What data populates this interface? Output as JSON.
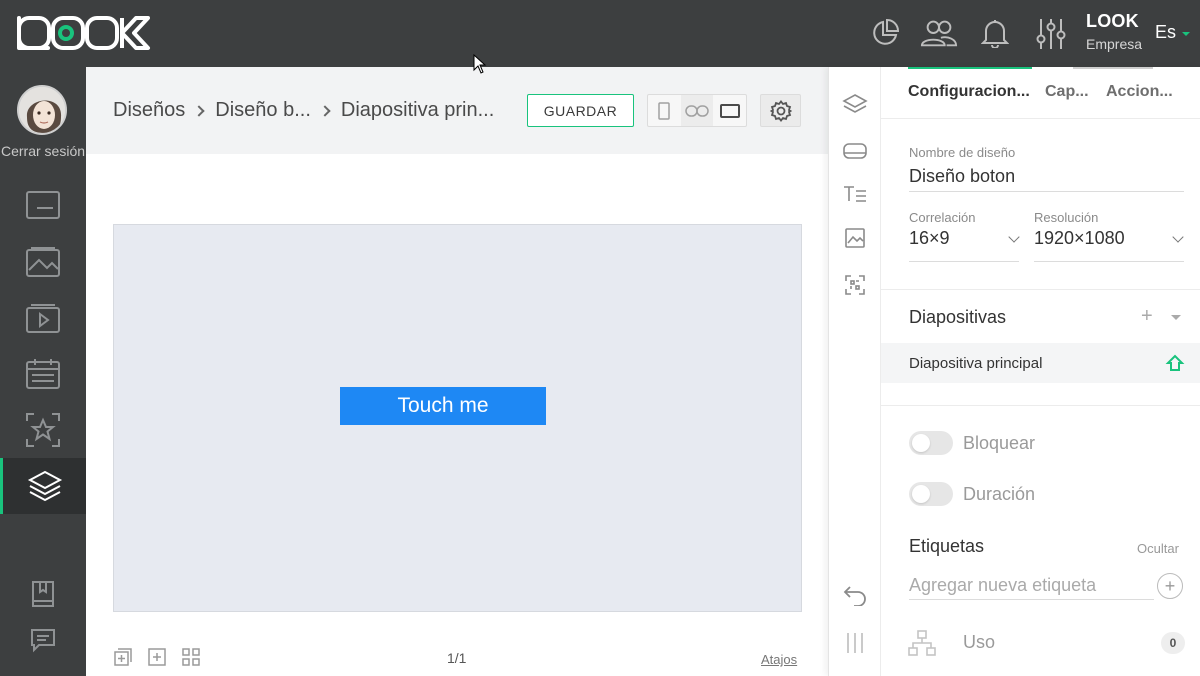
{
  "header": {
    "logo_text": "LOOK",
    "user_name": "LOOK",
    "company": "Empresa",
    "language": "Es",
    "icons": [
      "pie-chart-icon",
      "users-icon",
      "bell-icon",
      "sliders-icon"
    ]
  },
  "sidebar": {
    "logout_label": "Cerrar sesión",
    "items": [
      "screens-icon",
      "images-icon",
      "playlist-icon",
      "calendar-icon",
      "favorites-icon",
      "designs-icon",
      "book-icon",
      "chat-icon"
    ],
    "active": "designs-icon"
  },
  "breadcrumb": {
    "items": [
      "Diseños",
      "Diseño b...",
      "Diapositiva prin..."
    ]
  },
  "toolbar": {
    "save_label": "GUARDAR"
  },
  "canvas": {
    "button_label": "Touch me",
    "button_color": "#1e88f4",
    "background": "#e7eaf1"
  },
  "footer": {
    "page_count": "1/1",
    "shortcuts_label": "Atajos"
  },
  "panel": {
    "tabs": [
      "Configuracion...",
      "Cap...",
      "Accion..."
    ],
    "active_tab": "Configuracion...",
    "design_name_label": "Nombre de diseño",
    "design_name_value": "Diseño boton",
    "ratio_label": "Correlación",
    "ratio_value": "16×9",
    "resolution_label": "Resolución",
    "resolution_value": "1920×1080",
    "slides_title": "Diapositivas",
    "slides": [
      "Diapositiva principal"
    ],
    "lock_label": "Bloquear",
    "duration_label": "Duración",
    "tags_title": "Etiquetas",
    "hide_label": "Ocultar",
    "tag_placeholder": "Agregar nueva etiqueta",
    "usage_label": "Uso",
    "usage_count": "0"
  },
  "colors": {
    "accent": "#19c37d",
    "topbar": "#3d3f40"
  }
}
